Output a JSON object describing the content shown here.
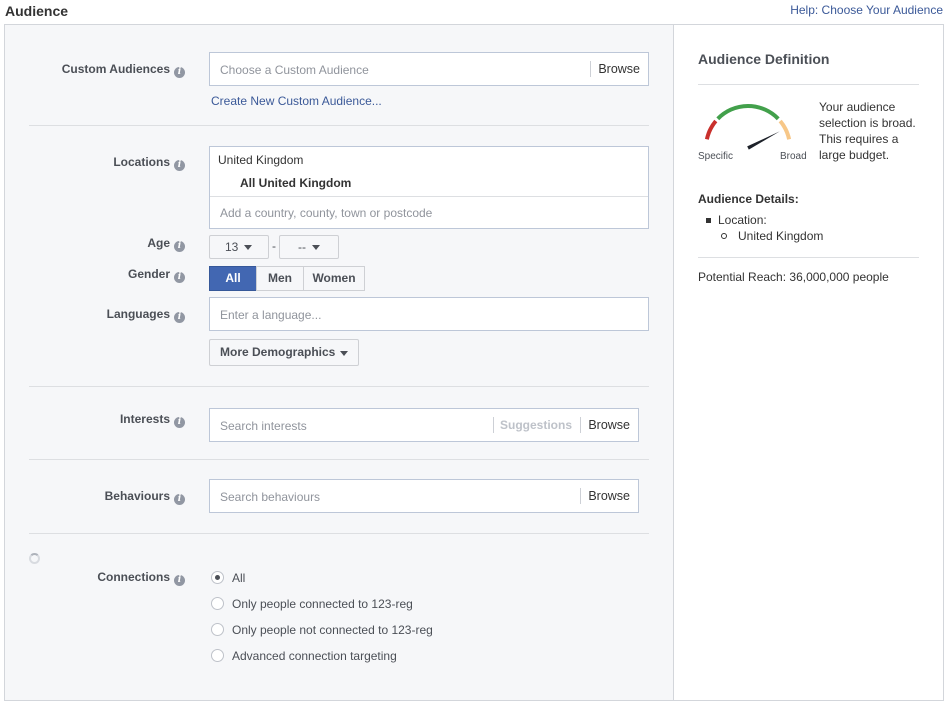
{
  "header": {
    "title": "Audience",
    "help_link": "Help: Choose Your Audience"
  },
  "custom_audiences": {
    "label": "Custom Audiences",
    "placeholder": "Choose a Custom Audience",
    "browse": "Browse",
    "create_link": "Create New Custom Audience..."
  },
  "locations": {
    "label": "Locations",
    "country": "United Kingdom",
    "scope": "All United Kingdom",
    "placeholder": "Add a country, county, town or postcode"
  },
  "age": {
    "label": "Age",
    "min": "13",
    "separator": "-",
    "max": "--"
  },
  "gender": {
    "label": "Gender",
    "options": [
      "All",
      "Men",
      "Women"
    ],
    "selected": "All"
  },
  "languages": {
    "label": "Languages",
    "placeholder": "Enter a language..."
  },
  "more_demographics": "More Demographics",
  "interests": {
    "label": "Interests",
    "placeholder": "Search interests",
    "suggestions": "Suggestions",
    "browse": "Browse"
  },
  "behaviours": {
    "label": "Behaviours",
    "placeholder": "Search behaviours",
    "browse": "Browse"
  },
  "connections": {
    "label": "Connections",
    "options": [
      "All",
      "Only people connected to 123-reg",
      "Only people not connected to 123-reg",
      "Advanced connection targeting"
    ],
    "selected_index": 0
  },
  "audience_definition": {
    "title": "Audience Definition",
    "gauge": {
      "specific_label": "Specific",
      "broad_label": "Broad",
      "level": 0.9,
      "colors": {
        "red": "#c9302c",
        "green": "#42a04b",
        "orange": "#f7c788",
        "needle": "#1d2129"
      }
    },
    "description": "Your audience selection is broad. This requires a large budget.",
    "details_title": "Audience Details:",
    "detail_key": "Location:",
    "detail_value": "United Kingdom",
    "potential_reach": "Potential Reach: 36,000,000 people"
  },
  "colors": {
    "link": "#3b5998",
    "accent": "#4267b2",
    "panel_bg": "#f6f7f9",
    "border": "#d3d6db"
  }
}
